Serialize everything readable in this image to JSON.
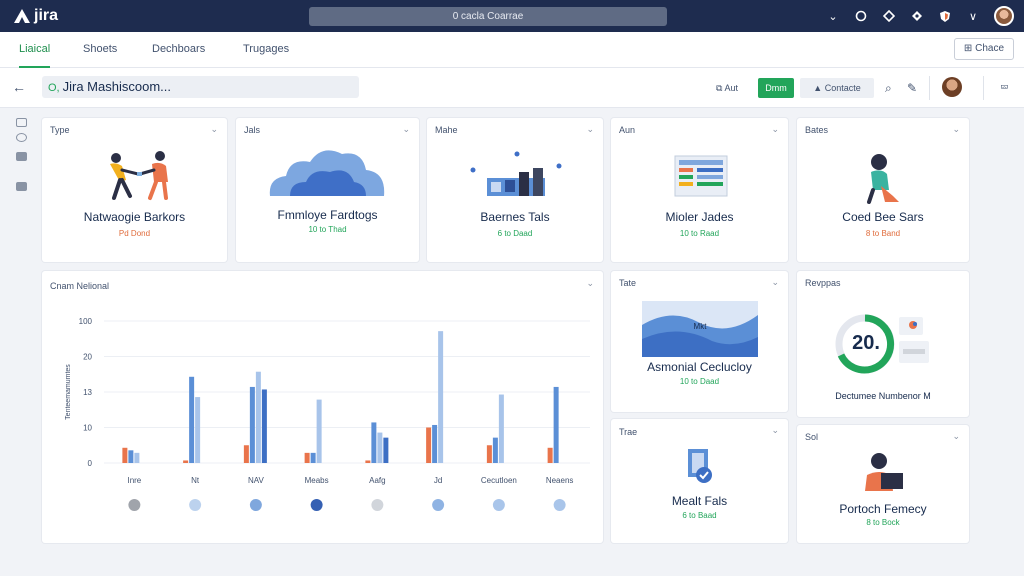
{
  "app": {
    "logo_text": "jira",
    "search_label": "0 cacla Coarrae"
  },
  "tabs": [
    {
      "label": "Liaical",
      "active": true
    },
    {
      "label": "Shoets",
      "active": false
    },
    {
      "label": "Dechboars",
      "active": false
    },
    {
      "label": "Trugages",
      "active": false
    }
  ],
  "tab_action": {
    "label": "Chace"
  },
  "toolbar": {
    "search_value": "Jira Mashiscoom...",
    "add_label": "Aut",
    "share_label": "Dmm",
    "contact_label": "Contacte"
  },
  "cards": [
    {
      "label": "Type",
      "title": "Natwaogie Barkors",
      "sub": "Pd Dond",
      "sub_color": "orange"
    },
    {
      "label": "Jals",
      "title": "Fmmloye Fardtogs",
      "sub": "10 to Thad",
      "sub_color": "green"
    },
    {
      "label": "Mahe",
      "title": "Baernes Tals",
      "sub": "6 to Daad",
      "sub_color": "green"
    },
    {
      "label": "Aun",
      "title": "Mioler Jades",
      "sub": "10 to Raad",
      "sub_color": "green"
    },
    {
      "label": "Bates",
      "title": "Coed Bee Sars",
      "sub": "8 to Band",
      "sub_color": "orange"
    },
    {
      "label": "Tate",
      "title": "Asmonial Ceclucloy",
      "sub": "10 to Daad",
      "sub_color": "green"
    },
    {
      "label": "Revppas",
      "title": "Dectumee Numbenor M",
      "sub": "",
      "sub_color": "green",
      "gauge_value": "20."
    },
    {
      "label": "Trae",
      "title": "Mealt Fals",
      "sub": "6 to Baad",
      "sub_color": "green"
    },
    {
      "label": "Sol",
      "title": "Portoch Femecy",
      "sub": "8 to Bock",
      "sub_color": "green"
    }
  ],
  "chart_data": {
    "type": "bar",
    "title": "Cnam Nelional",
    "ylabel": "Tenteemamumtes",
    "yticks": [
      "0",
      "10",
      "13",
      "20",
      "100"
    ],
    "categories": [
      "Inre",
      "Nt",
      "NAV",
      "Meabs",
      "Aafg",
      "Jd",
      "Cecutloen",
      "Neaens"
    ],
    "series": [
      {
        "color": "#e9744b",
        "values": [
          3,
          0.5,
          3.5,
          2,
          0.5,
          7,
          3.5,
          3
        ]
      },
      {
        "color": "#5b8fd6",
        "values": [
          2.5,
          17,
          15,
          2,
          8,
          7.5,
          5,
          15
        ]
      },
      {
        "color": "#a8c4ea",
        "values": [
          2,
          13,
          18,
          12.5,
          6,
          26,
          13.5,
          0
        ]
      },
      {
        "color": "#3d6fc4",
        "values": [
          0,
          0,
          14.5,
          0,
          5,
          0,
          0,
          0
        ]
      }
    ],
    "dot_colors": [
      "#a0a4ab",
      "#bcd2ee",
      "#7fa7dd",
      "#3560b3",
      "#d1d5db",
      "#8fb3e3",
      "#a9c5ea",
      "#a9c5ea"
    ],
    "ylim": [
      0,
      28
    ],
    "legend": "bottom"
  }
}
